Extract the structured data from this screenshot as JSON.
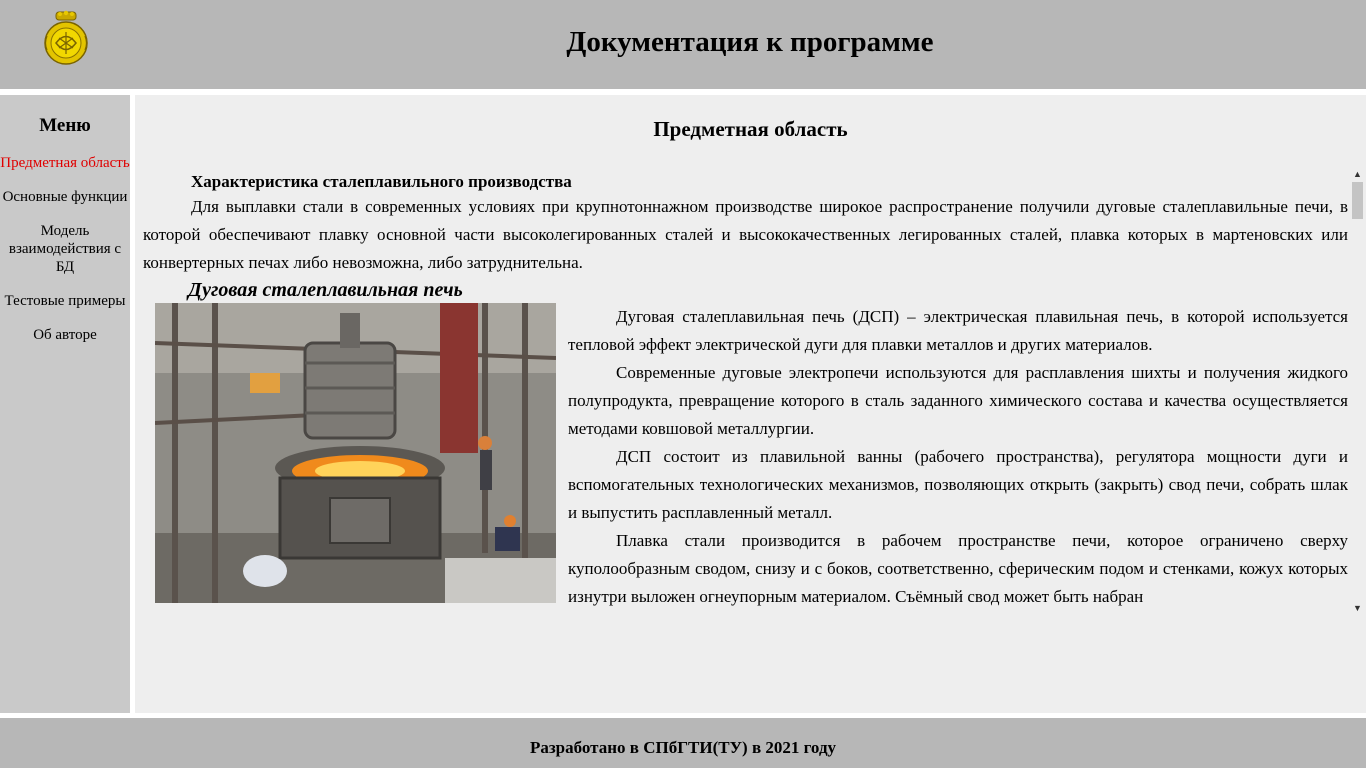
{
  "header": {
    "title": "Документация к программе",
    "logo_icon": "crowned-emblem-icon",
    "logo_color": "#d4b300"
  },
  "sidebar": {
    "title": "Меню",
    "items": [
      {
        "label": "Предметная область",
        "active": true
      },
      {
        "label": "Основные функции",
        "active": false
      },
      {
        "label": "Модель взаимодействия с БД",
        "active": false
      },
      {
        "label": "Тестовые примеры",
        "active": false
      },
      {
        "label": "Об авторе",
        "active": false
      }
    ],
    "active_color": "#e00000"
  },
  "main": {
    "section_title": "Предметная область",
    "subheading": "Характеристика сталеплавильного производства",
    "intro": "Для выплавки стали в современных условиях при крупнотоннажном производстве широкое распространение получили дуговые сталеплавильные печи, в которой обеспечивают плавку основной части высоколегированных сталей и высококачественных легированных сталей, плавка которых в мартеновских или конвертерных печах либо невозможна, либо затруднительна.",
    "furnace_title": "Дуговая сталеплавильная печь",
    "furnace_image": "electric-arc-furnace-photo",
    "paragraphs": [
      "Дуговая сталеплавильная печь (ДСП) – электрическая плавильная печь, в которой используется тепловой эффект электрической дуги для плавки металлов и других материалов.",
      "Современные дуговые электропечи используются для расплавления шихты и получения жидкого полупродукта, превращение которого в сталь заданного химического состава и качества осуществляется методами ковшовой металлургии.",
      "ДСП состоит из плавильной ванны (рабочего пространства), регулятора мощности дуги и вспомогательных технологических механизмов, позволяющих открыть (закрыть) свод печи, собрать шлак и выпустить расплавленный металл.",
      "Плавка стали производится в рабочем пространстве печи, которое ограничено сверху куполообразным сводом, снизу и с боков, соответственно, сферическим подом и стенками, кожух которых изнутри выложен огнеупорным материалом. Съёмный свод может быть набран"
    ]
  },
  "footer": {
    "text": "Разработано в СПбГТИ(ТУ) в 2021 году"
  },
  "colors": {
    "header_bg": "#b7b7b7",
    "sidebar_bg": "#c9c9c9",
    "content_bg": "#eeeeee"
  }
}
